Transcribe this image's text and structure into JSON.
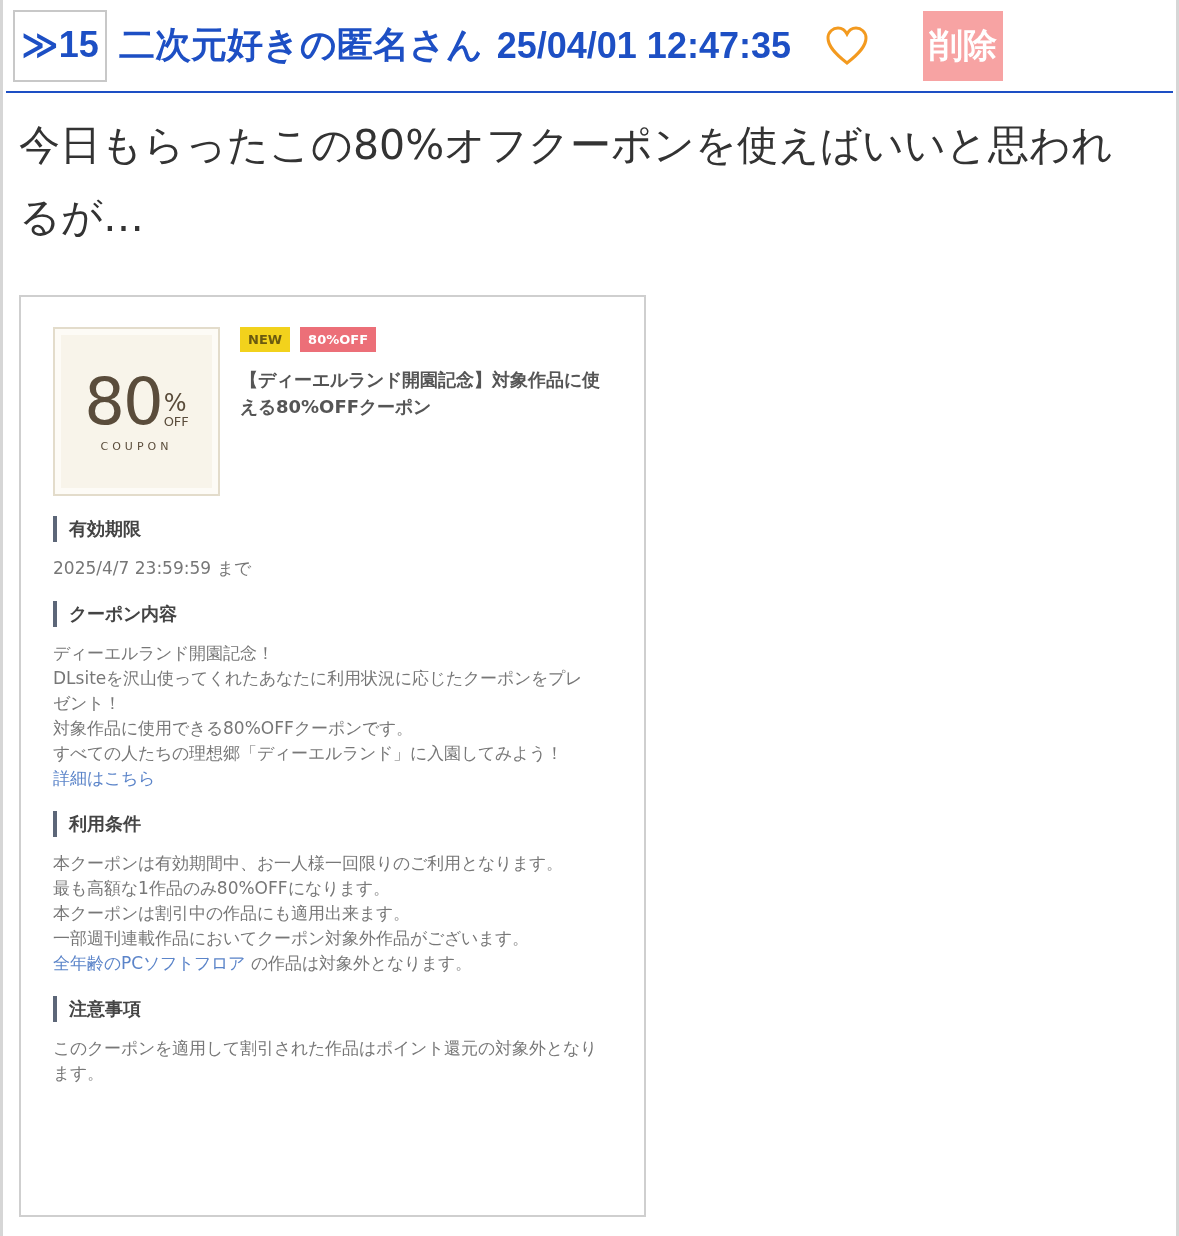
{
  "post": {
    "number": "≫15",
    "author": "二次元好きの匿名さん",
    "date": "25/04/01 12:47:35",
    "liked": false,
    "delete_label": "削除"
  },
  "body": "今日もらったこの80%オフクーポンを使えばいいと思われるが…",
  "screenshot": {
    "coupon_art": {
      "big": "80",
      "percent": "%",
      "off": "OFF",
      "word": "COUPON"
    },
    "tags": [
      {
        "label": "NEW",
        "color": "#f2d21c"
      },
      {
        "label": "80%OFF",
        "color": "#ec6f78"
      }
    ],
    "title": "【ディーエルランド開園記念】対象作品に使える80%OFFクーポン",
    "sections": [
      {
        "heading": "有効期限",
        "lines": [
          {
            "kind": "text",
            "text": "2025/4/7 23:59:59 まで"
          }
        ]
      },
      {
        "heading": "クーポン内容",
        "lines": [
          {
            "kind": "text",
            "text": "ディーエルランド開園記念！"
          },
          {
            "kind": "text",
            "text": "DLsiteを沢山使ってくれたあなたに利用状況に応じたクーポンをプレゼント！"
          },
          {
            "kind": "text",
            "text": "対象作品に使用できる80%OFFクーポンです。"
          },
          {
            "kind": "text",
            "text": "すべての人たちの理想郷「ディーエルランド」に入園してみよう！"
          },
          {
            "kind": "link",
            "text": "詳細はこちら"
          }
        ]
      },
      {
        "heading": "利用条件",
        "lines": [
          {
            "kind": "text",
            "text": "本クーポンは有効期間中、お一人様一回限りのご利用となります。"
          },
          {
            "kind": "text",
            "text": "最も高額な1作品のみ80%OFFになります。"
          },
          {
            "kind": "text",
            "text": "本クーポンは割引中の作品にも適用出来ます。"
          },
          {
            "kind": "text",
            "text": "一部週刊連載作品においてクーポン対象外作品がございます。"
          },
          {
            "kind": "linked",
            "link": "全年齢のPCソフトフロア",
            "text": " の作品は対象外となります。"
          }
        ]
      },
      {
        "heading": "注意事項",
        "lines": [
          {
            "kind": "text",
            "text": "このクーポンを適用して割引された作品はポイント還元の対象外となります。"
          }
        ]
      }
    ]
  }
}
